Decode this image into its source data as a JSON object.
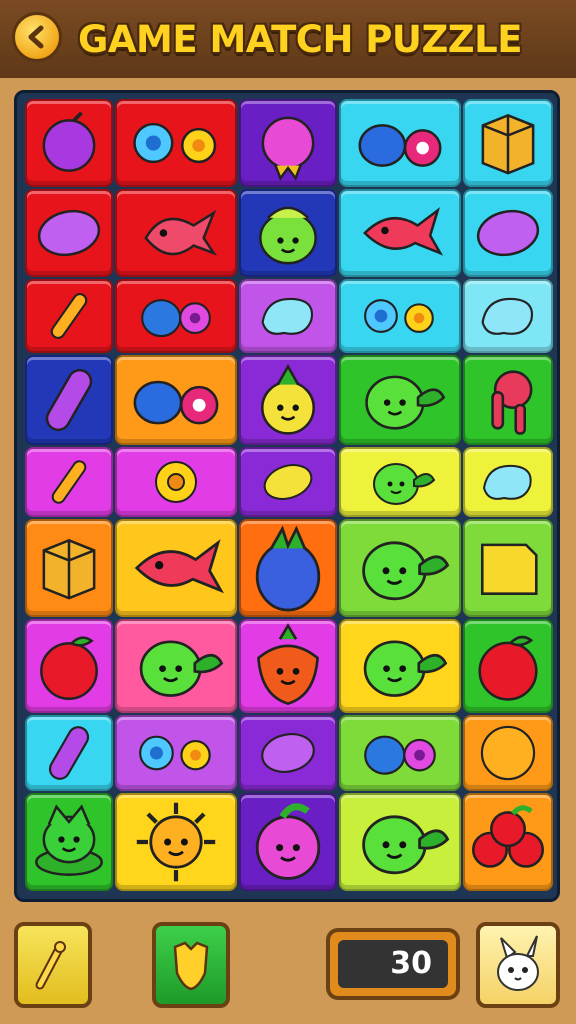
{
  "header": {
    "title": "GAME MATCH PUZZLE",
    "back_icon": "back-arrow-icon"
  },
  "board": {
    "rows": 9,
    "cols": 5,
    "tiles": [
      [
        {
          "bg": "#e8141c",
          "icon": "plum"
        },
        {
          "bg": "#e8141c",
          "icon": "flowers-pair"
        },
        {
          "bg": "#6a1fc4",
          "icon": "berry-spiky"
        },
        {
          "bg": "#38d6f0",
          "icon": "fruit-pair"
        },
        {
          "bg": "#38d6f0",
          "icon": "crate"
        }
      ],
      [
        {
          "bg": "#e8141c",
          "icon": "bean"
        },
        {
          "bg": "#e8141c",
          "icon": "bird-fish"
        },
        {
          "bg": "#2238b8",
          "icon": "turnip-face"
        },
        {
          "bg": "#38d6f0",
          "icon": "fish"
        },
        {
          "bg": "#38d6f0",
          "icon": "bean"
        }
      ],
      [
        {
          "bg": "#e8141c",
          "icon": "stick"
        },
        {
          "bg": "#e8141c",
          "icon": "fruit-flower"
        },
        {
          "bg": "#c155ea",
          "icon": "leaf-blob"
        },
        {
          "bg": "#38d6f0",
          "icon": "flowers-pair"
        },
        {
          "bg": "#7ee6f4",
          "icon": "leaf-blob"
        }
      ],
      [
        {
          "bg": "#2238b8",
          "icon": "capsule"
        },
        {
          "bg": "#ff9a18",
          "icon": "fruit-pair"
        },
        {
          "bg": "#8a2ad6",
          "icon": "pineapple-face"
        },
        {
          "bg": "#2fc42a",
          "icon": "bird-face"
        },
        {
          "bg": "#2fc42a",
          "icon": "mushroom"
        }
      ],
      [
        {
          "bg": "#e23ce6",
          "icon": "stick"
        },
        {
          "bg": "#e23ce6",
          "icon": "flower"
        },
        {
          "bg": "#8a2ad6",
          "icon": "lemon"
        },
        {
          "bg": "#eef23a",
          "icon": "bird-face"
        },
        {
          "bg": "#eef23a",
          "icon": "leaf-blob"
        }
      ],
      [
        {
          "bg": "#ff8a14",
          "icon": "crate"
        },
        {
          "bg": "#ffc61c",
          "icon": "fish"
        },
        {
          "bg": "#ff6f10",
          "icon": "pineapple"
        },
        {
          "bg": "#7edb3a",
          "icon": "bird-face"
        },
        {
          "bg": "#7edb3a",
          "icon": "box"
        }
      ],
      [
        {
          "bg": "#e23ce6",
          "icon": "apple"
        },
        {
          "bg": "#ff5aa0",
          "icon": "bird-face"
        },
        {
          "bg": "#e23ce6",
          "icon": "strawberry-face"
        },
        {
          "bg": "#ffd61c",
          "icon": "bird-face"
        },
        {
          "bg": "#2fc42a",
          "icon": "apple"
        }
      ],
      [
        {
          "bg": "#38d6f0",
          "icon": "capsule"
        },
        {
          "bg": "#c155ea",
          "icon": "flowers-pair"
        },
        {
          "bg": "#8a2ad6",
          "icon": "bean"
        },
        {
          "bg": "#7edb3a",
          "icon": "fruit-flower"
        },
        {
          "bg": "#ff9a18",
          "icon": "orange"
        }
      ],
      [
        {
          "bg": "#2fc42a",
          "icon": "bush-face"
        },
        {
          "bg": "#ffd61c",
          "icon": "sun-face"
        },
        {
          "bg": "#6a1fc4",
          "icon": "plum-face"
        },
        {
          "bg": "#c7ef3c",
          "icon": "bird-face"
        },
        {
          "bg": "#ff9a18",
          "icon": "cherries"
        }
      ]
    ]
  },
  "footer": {
    "hint_icon": "magic-wand-icon",
    "shuffle_icon": "shield-icon",
    "score": "30",
    "mascot_icon": "bunny-icon"
  }
}
